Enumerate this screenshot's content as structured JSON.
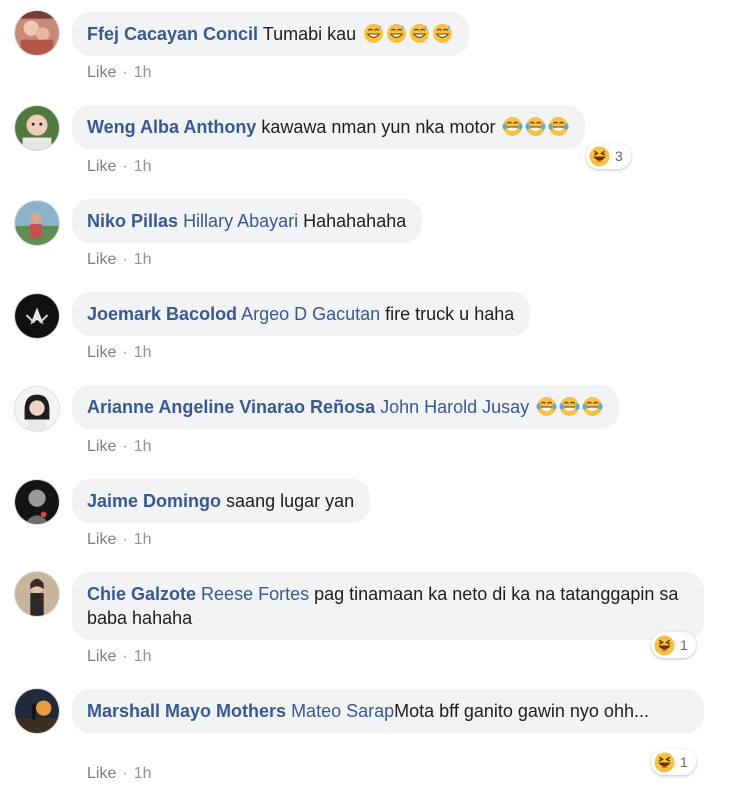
{
  "comments": [
    {
      "author": "Ffej Cacayan Concil",
      "mention": "",
      "text": "Tumabi kau",
      "emojis": [
        "grin-sweat-icon",
        "grin-sweat-icon",
        "grin-sweat-icon",
        "grin-sweat-icon"
      ],
      "like_label": "Like",
      "time": "1h",
      "reaction_count": ""
    },
    {
      "author": "Weng Alba Anthony",
      "mention": "",
      "text": "kawawa nman yun nka motor",
      "emojis": [
        "tears-of-joy-icon",
        "tears-of-joy-icon",
        "tears-of-joy-icon"
      ],
      "like_label": "Like",
      "time": "1h",
      "reaction_count": "3"
    },
    {
      "author": "Niko Pillas",
      "mention": "Hillary Abayari",
      "text": "Hahahahaha",
      "emojis": [],
      "like_label": "Like",
      "time": "1h",
      "reaction_count": ""
    },
    {
      "author": "Joemark Bacolod",
      "mention": "Argeo D Gacutan",
      "text": "fire truck u haha",
      "emojis": [],
      "like_label": "Like",
      "time": "1h",
      "reaction_count": ""
    },
    {
      "author": "Arianne Angeline Vinarao Reñosa",
      "mention": "John Harold Jusay",
      "text": "",
      "emojis": [
        "tears-of-joy-icon",
        "tears-of-joy-icon",
        "tears-of-joy-icon"
      ],
      "like_label": "Like",
      "time": "1h",
      "reaction_count": ""
    },
    {
      "author": "Jaime Domingo",
      "mention": "",
      "text": "saang lugar yan",
      "emojis": [],
      "like_label": "Like",
      "time": "1h",
      "reaction_count": ""
    },
    {
      "author": "Chie Galzote",
      "mention": "Reese Fortes",
      "text": "pag tinamaan ka neto di ka na tatanggapin sa baba hahaha",
      "emojis": [],
      "like_label": "Like",
      "time": "1h",
      "reaction_count": "1"
    },
    {
      "author": "Marshall Mayo Mothers",
      "mention": "Mateo Sarap",
      "text": "Mota bff ganito gawin nyo ohh...",
      "emojis": [],
      "like_label": "Like",
      "time": "1h",
      "reaction_count": "1"
    }
  ],
  "colors": {
    "author": "#385898",
    "bubble": "#f2f3f5",
    "meta": "#90949c"
  }
}
